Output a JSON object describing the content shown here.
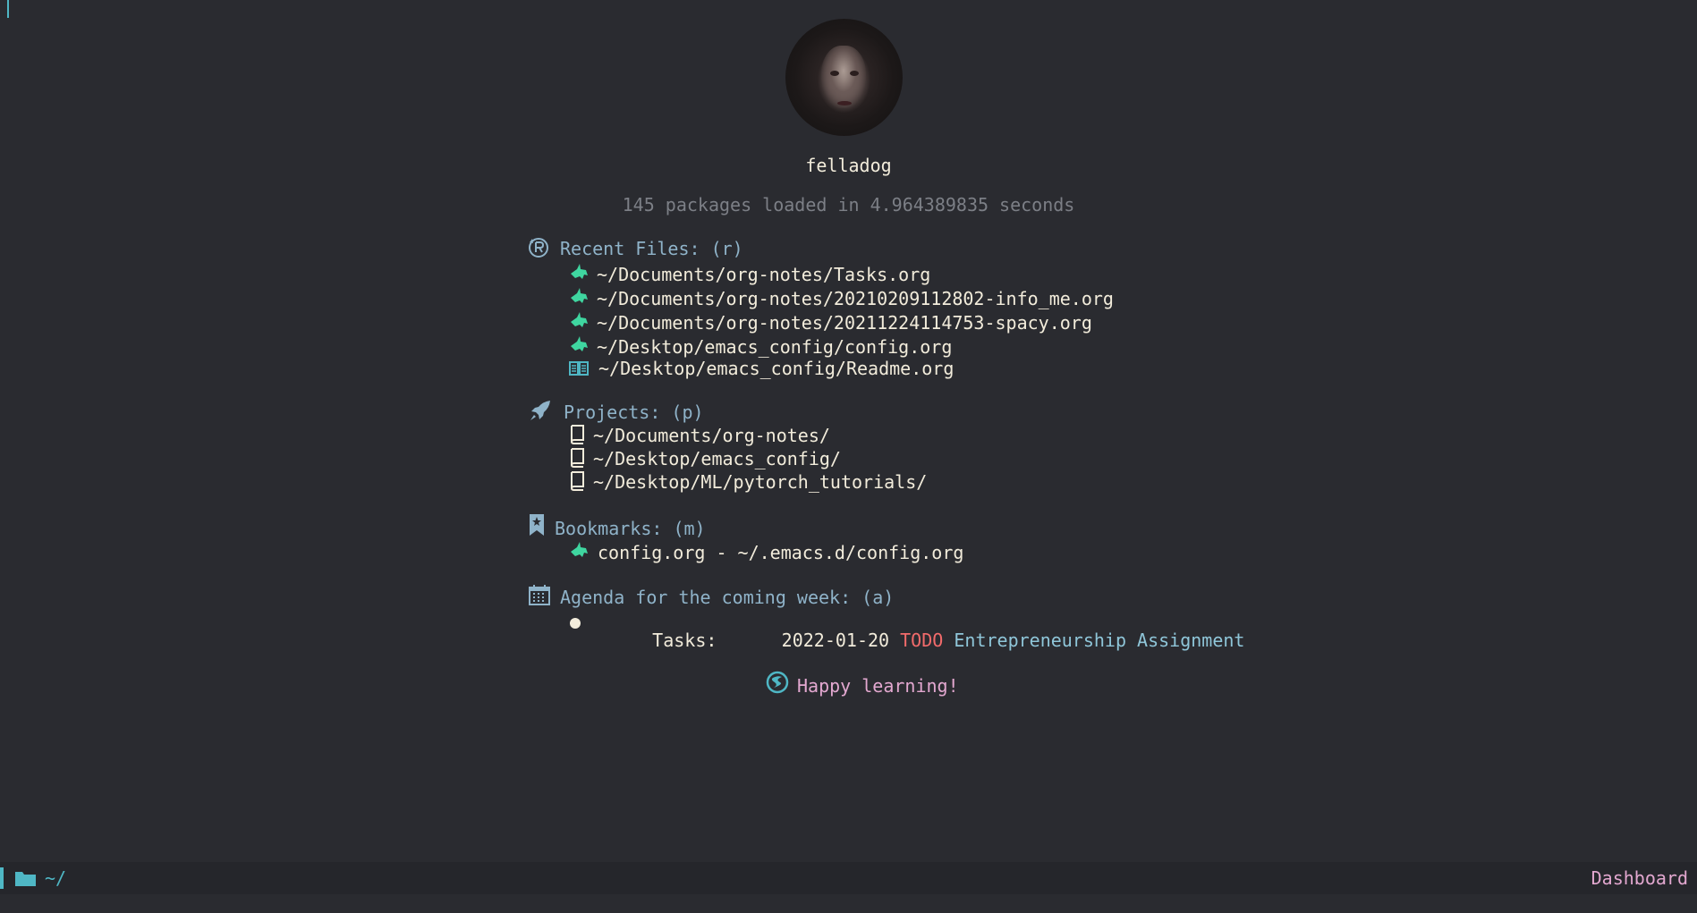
{
  "profile": {
    "username": "felladog",
    "load_info": "145 packages loaded in 4.964389835 seconds"
  },
  "recent_files": {
    "title": "Recent Files: (r)",
    "items": [
      {
        "label": "~/Documents/org-notes/Tasks.org",
        "icon": "unicorn-icon"
      },
      {
        "label": "~/Documents/org-notes/20210209112802-info_me.org",
        "icon": "unicorn-icon"
      },
      {
        "label": "~/Documents/org-notes/20211224114753-spacy.org",
        "icon": "unicorn-icon"
      },
      {
        "label": "~/Desktop/emacs_config/config.org",
        "icon": "unicorn-icon"
      },
      {
        "label": "~/Desktop/emacs_config/Readme.org",
        "icon": "book-open-icon"
      }
    ]
  },
  "projects": {
    "title": "Projects: (p)",
    "items": [
      {
        "label": "~/Documents/org-notes/"
      },
      {
        "label": "~/Desktop/emacs_config/"
      },
      {
        "label": "~/Desktop/ML/pytorch_tutorials/"
      }
    ]
  },
  "bookmarks": {
    "title": "Bookmarks: (m)",
    "items": [
      {
        "label": "config.org - ~/.emacs.d/config.org"
      }
    ]
  },
  "agenda": {
    "title": "Agenda for the coming week: (a)",
    "items": [
      {
        "category": "Tasks:",
        "date": "2022-01-20",
        "keyword": "TODO",
        "heading": "Entrepreneurship Assignment"
      }
    ]
  },
  "footer_message": "Happy learning!",
  "modeline": {
    "path": "~/",
    "mode": "Dashboard"
  },
  "colors": {
    "background": "#2a2b30",
    "accent": "#4fb7c5",
    "icon_green": "#3fd6a0",
    "todo": "#f26b6b",
    "pink": "#e3a8d0"
  }
}
